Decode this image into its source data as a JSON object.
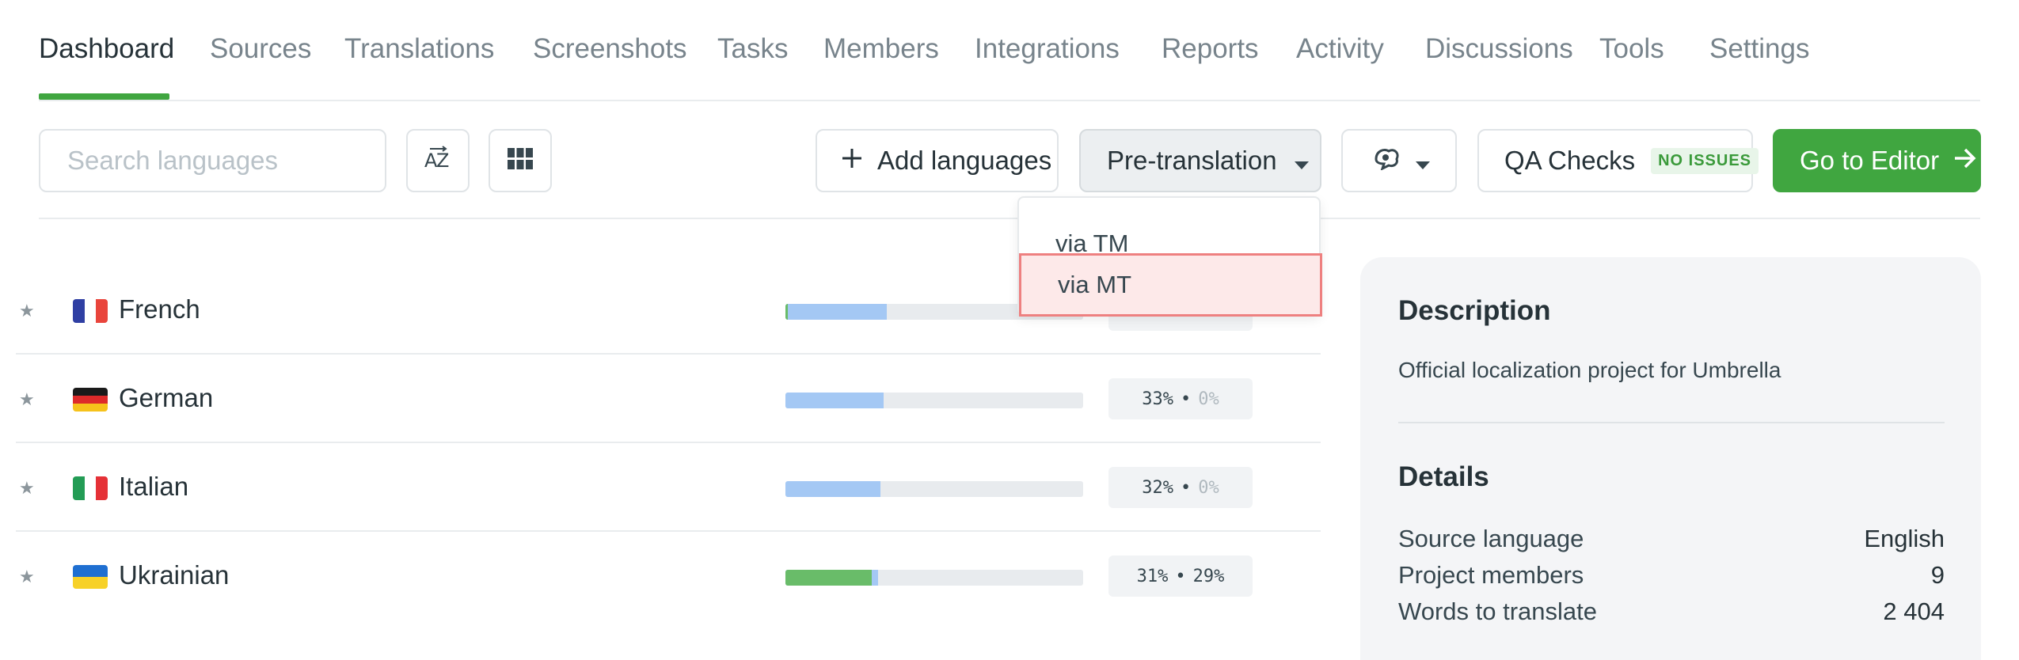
{
  "tabs": [
    {
      "label": "Dashboard",
      "active": true
    },
    {
      "label": "Sources"
    },
    {
      "label": "Translations"
    },
    {
      "label": "Screenshots"
    },
    {
      "label": "Tasks"
    },
    {
      "label": "Members"
    },
    {
      "label": "Integrations"
    },
    {
      "label": "Reports"
    },
    {
      "label": "Activity"
    },
    {
      "label": "Discussions"
    },
    {
      "label": "Tools"
    },
    {
      "label": "Settings"
    }
  ],
  "toolbar": {
    "search_placeholder": "Search languages",
    "sort_icon": "sort-az-icon",
    "grid_icon": "grid-view-icon",
    "add_languages_label": "Add languages",
    "pretranslation_label": "Pre-translation",
    "ai_icon": "ai-assistant-icon",
    "qa_checks_label": "QA Checks",
    "qa_checks_badge": "NO ISSUES",
    "go_to_editor_label": "Go to Editor"
  },
  "dropdown": {
    "items": [
      {
        "label": "via TM"
      },
      {
        "label": "via MT",
        "highlighted": true
      }
    ]
  },
  "languages": [
    {
      "name": "French",
      "translated_pct": 0.34,
      "approved_pct": 0.0,
      "translated_text": "",
      "approved_text": "",
      "flag": [
        "#2f3fa3",
        "#ffffff",
        "#e9453c"
      ]
    },
    {
      "name": "German",
      "translated_pct": 0.33,
      "approved_pct": 0.0,
      "translated_text": "33%",
      "approved_text": "0%",
      "flag": [
        "#1a1a1a",
        "#dd2a2a",
        "#f6c21b"
      ]
    },
    {
      "name": "Italian",
      "translated_pct": 0.32,
      "approved_pct": 0.0,
      "translated_text": "32%",
      "approved_text": "0%",
      "flag": [
        "#239c55",
        "#ffffff",
        "#e53137"
      ]
    },
    {
      "name": "Ukrainian",
      "translated_pct": 0.31,
      "approved_pct": 0.29,
      "translated_text": "31%",
      "approved_text": "29%",
      "flag": [
        "#1f6fd1",
        "#f7d128"
      ]
    }
  ],
  "panel": {
    "description_title": "Description",
    "description": "Official localization project for Umbrella",
    "details_title": "Details",
    "details": [
      {
        "label": "Source language",
        "value": "English"
      },
      {
        "label": "Project members",
        "value": "9"
      },
      {
        "label": "Words to translate",
        "value": "2 404"
      }
    ]
  },
  "colors": {
    "accent_green": "#40a640",
    "translated_blue": "#a4c8f4",
    "approved_green": "#69bc69",
    "highlight_red": "#ee8080"
  }
}
